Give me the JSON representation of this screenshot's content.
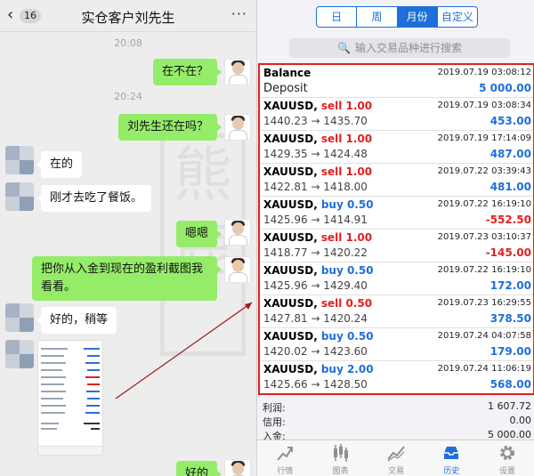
{
  "chat": {
    "back_count": "16",
    "title": "实仓客户刘先生",
    "more": "···",
    "timestamps": [
      "20:08",
      "20:24"
    ],
    "messages": [
      {
        "side": "right",
        "text": "在不在？"
      },
      {
        "side": "right",
        "text": "刘先生还在吗？"
      },
      {
        "side": "left",
        "text": "在的"
      },
      {
        "side": "left",
        "text": "刚才去吃了餐饭。"
      },
      {
        "side": "right",
        "text": "嗯嗯"
      },
      {
        "side": "right",
        "text": "把你从入金到现在的盈利截图我看看。"
      },
      {
        "side": "left",
        "text": "好的，稍等"
      },
      {
        "side": "right",
        "text": "好的"
      }
    ],
    "watermark": "熊鹿"
  },
  "app": {
    "segments": [
      {
        "label": "日",
        "active": false
      },
      {
        "label": "周",
        "active": false
      },
      {
        "label": "月份",
        "active": true
      },
      {
        "label": "自定义",
        "active": false
      }
    ],
    "search_placeholder": "输入交易品种进行搜索",
    "balance": {
      "title": "Balance",
      "datetime": "2019.07.19 03:08:12",
      "sub": "Deposit",
      "amount": "5 000.00"
    },
    "trades": [
      {
        "symbol": "XAUUSD,",
        "action": "sell 1.00",
        "side": "sell",
        "datetime": "2019.07.19 03:08:34",
        "prices": "1440.23 → 1435.70",
        "profit": "453.00",
        "neg": false
      },
      {
        "symbol": "XAUUSD,",
        "action": "sell 1.00",
        "side": "sell",
        "datetime": "2019.07.19 17:14:09",
        "prices": "1429.35 → 1424.48",
        "profit": "487.00",
        "neg": false
      },
      {
        "symbol": "XAUUSD,",
        "action": "sell 1.00",
        "side": "sell",
        "datetime": "2019.07.22 03:39:43",
        "prices": "1422.81 → 1418.00",
        "profit": "481.00",
        "neg": false
      },
      {
        "symbol": "XAUUSD,",
        "action": "buy 0.50",
        "side": "buy",
        "datetime": "2019.07.22 16:19:10",
        "prices": "1425.96 → 1414.91",
        "profit": "-552.50",
        "neg": true
      },
      {
        "symbol": "XAUUSD,",
        "action": "sell 1.00",
        "side": "sell",
        "datetime": "2019.07.23 03:10:37",
        "prices": "1418.77 → 1420.22",
        "profit": "-145.00",
        "neg": true
      },
      {
        "symbol": "XAUUSD,",
        "action": "buy 0.50",
        "side": "buy",
        "datetime": "2019.07.22 16:19:10",
        "prices": "1425.96 → 1429.40",
        "profit": "172.00",
        "neg": false
      },
      {
        "symbol": "XAUUSD,",
        "action": "sell 0.50",
        "side": "sell",
        "datetime": "2019.07.23 16:29:55",
        "prices": "1427.81 → 1420.24",
        "profit": "378.50",
        "neg": false
      },
      {
        "symbol": "XAUUSD,",
        "action": "buy 0.50",
        "side": "buy",
        "datetime": "2019.07.24 04:07:58",
        "prices": "1420.02 → 1423.60",
        "profit": "179.00",
        "neg": false
      },
      {
        "symbol": "XAUUSD,",
        "action": "buy 2.00",
        "side": "buy",
        "datetime": "2019.07.24 11:06:19",
        "prices": "1425.66 → 1428.50",
        "profit": "568.00",
        "neg": false
      }
    ],
    "summary": [
      {
        "label": "利润:",
        "value": "1 607.72"
      },
      {
        "label": "信用:",
        "value": "0.00"
      },
      {
        "label": "入金:",
        "value": "5 000.00"
      }
    ],
    "tabs": [
      {
        "label": "行情",
        "icon": "quotes-icon",
        "active": false
      },
      {
        "label": "图表",
        "icon": "chart-icon",
        "active": false
      },
      {
        "label": "交易",
        "icon": "trade-icon",
        "active": false
      },
      {
        "label": "历史",
        "icon": "history-icon",
        "active": true
      },
      {
        "label": "设置",
        "icon": "settings-icon",
        "active": false
      }
    ],
    "colors": {
      "accent": "#1e6fd9",
      "sell": "#e02020",
      "highlight_box": "#e02020",
      "bubble": "#95ec69"
    }
  }
}
